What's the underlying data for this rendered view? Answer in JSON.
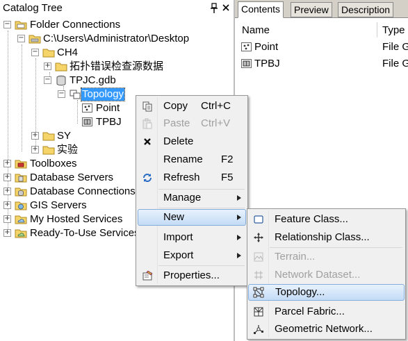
{
  "catalog": {
    "title": "Catalog Tree",
    "pin_glyph": "⇣",
    "close_glyph": "✕",
    "tree": [
      {
        "label": "Folder Connections",
        "toggle": "−",
        "icon": "folder-connection-icon"
      },
      {
        "label": "C:\\Users\\Administrator\\Desktop",
        "toggle": "−",
        "icon": "folder-icon"
      },
      {
        "label": "CH4",
        "toggle": "−",
        "icon": "folder-icon"
      },
      {
        "label": "拓扑错误检查源数据",
        "toggle": "+",
        "icon": "folder-icon"
      },
      {
        "label": "TPJC.gdb",
        "toggle": "−",
        "icon": "geodatabase-icon"
      },
      {
        "label": "Topology",
        "toggle": "−",
        "icon": "topology-icon"
      },
      {
        "label": "Point",
        "icon": "point-feature-class-icon"
      },
      {
        "label": "TPBJ",
        "icon": "polygon-feature-class-icon"
      },
      {
        "label": "SY",
        "toggle": "+",
        "icon": "folder-icon"
      },
      {
        "label": "实验",
        "toggle": "+",
        "icon": "folder-icon"
      },
      {
        "label": "Toolboxes",
        "toggle": "+",
        "icon": "toolbox-icon"
      },
      {
        "label": "Database Servers",
        "toggle": "+",
        "icon": "database-server-icon"
      },
      {
        "label": "Database Connections",
        "toggle": "+",
        "icon": "database-connection-icon"
      },
      {
        "label": "GIS Servers",
        "toggle": "+",
        "icon": "gis-server-icon"
      },
      {
        "label": "My Hosted Services",
        "toggle": "+",
        "icon": "hosted-services-icon"
      },
      {
        "label": "Ready-To-Use Services",
        "toggle": "+",
        "icon": "ready-to-use-icon"
      }
    ]
  },
  "contents": {
    "tabs": [
      {
        "label": "Contents"
      },
      {
        "label": "Preview"
      },
      {
        "label": "Description"
      }
    ],
    "columns": {
      "name": "Name",
      "type": "Type"
    },
    "rows": [
      {
        "name": "Point",
        "type": "File G"
      },
      {
        "name": "TPBJ",
        "type": "File G"
      }
    ]
  },
  "context_menu": {
    "items": [
      {
        "label": "Copy",
        "shortcut": "Ctrl+C",
        "icon": "copy-icon"
      },
      {
        "label": "Paste",
        "shortcut": "Ctrl+V",
        "icon": "paste-icon",
        "disabled": true
      },
      {
        "label": "Delete",
        "icon": "delete-icon"
      },
      {
        "label": "Rename",
        "shortcut": "F2"
      },
      {
        "label": "Refresh",
        "shortcut": "F5",
        "icon": "refresh-icon"
      },
      {
        "label": "Manage",
        "submenu": true
      },
      {
        "label": "New",
        "submenu": true,
        "highlighted": true
      },
      {
        "label": "Import",
        "submenu": true
      },
      {
        "label": "Export",
        "submenu": true
      },
      {
        "label": "Properties...",
        "icon": "properties-icon"
      }
    ]
  },
  "new_submenu": {
    "items": [
      {
        "label": "Feature Class...",
        "icon": "feature-class-icon"
      },
      {
        "label": "Relationship Class...",
        "icon": "relationship-class-icon"
      },
      {
        "label": "Terrain...",
        "icon": "terrain-icon",
        "disabled": true
      },
      {
        "label": "Network Dataset...",
        "icon": "network-dataset-icon",
        "disabled": true
      },
      {
        "label": "Topology...",
        "icon": "topology-icon",
        "highlighted": true
      },
      {
        "label": "Parcel Fabric...",
        "icon": "parcel-fabric-icon"
      },
      {
        "label": "Geometric Network...",
        "icon": "geometric-network-icon"
      }
    ]
  },
  "colors": {
    "selection": "#3399ff",
    "menu_highlight_border": "#84acdd",
    "folder_yellow": "#f5d56a"
  }
}
